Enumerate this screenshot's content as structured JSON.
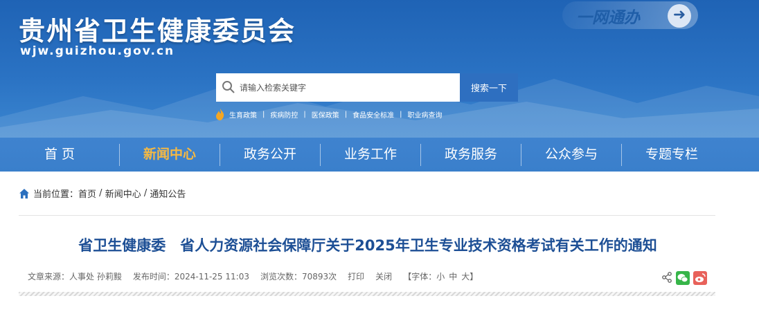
{
  "header": {
    "site_title": "贵州省卫生健康委员会",
    "site_url": "wjw.guizhou.gov.cn",
    "ywtb_label": "一网通办",
    "ywtb_arrow": "➜"
  },
  "search": {
    "placeholder": "请输入检索关键字",
    "button_label": "搜索一下"
  },
  "hot_links": [
    "生育政策",
    "疾病防控",
    "医保政策",
    "食品安全标准",
    "职业病查询"
  ],
  "hot_separator": "|",
  "nav": [
    "首 页",
    "新闻中心",
    "政务公开",
    "业务工作",
    "政务服务",
    "公众参与",
    "专题专栏"
  ],
  "breadcrumb": {
    "prefix": "当前位置：",
    "items": [
      "首页",
      "新闻中心",
      "通知公告"
    ],
    "separator": " / "
  },
  "article": {
    "title": "省卫生健康委　省人力资源社会保障厅关于2025年卫生专业技术资格考试有关工作的通知",
    "source": "文章来源：人事处 孙莉黢",
    "published": "发布时间：2024-11-25 11:03",
    "views": "浏览次数：70893次",
    "print_label": "打印",
    "close_label": "关闭",
    "font_prefix": "【字体：",
    "font_small": "小",
    "font_medium": "中",
    "font_large": "大",
    "font_suffix": "】"
  },
  "colors": {
    "brand_blue": "#2a72c3",
    "nav_blue": "#3f83cf",
    "active_nav": "#f6b942",
    "title_blue": "#1d4f95"
  },
  "icons": [
    "search-icon",
    "fire-icon",
    "home-icon",
    "share-icon",
    "wechat-icon",
    "weibo-icon",
    "arrow-right-icon"
  ]
}
